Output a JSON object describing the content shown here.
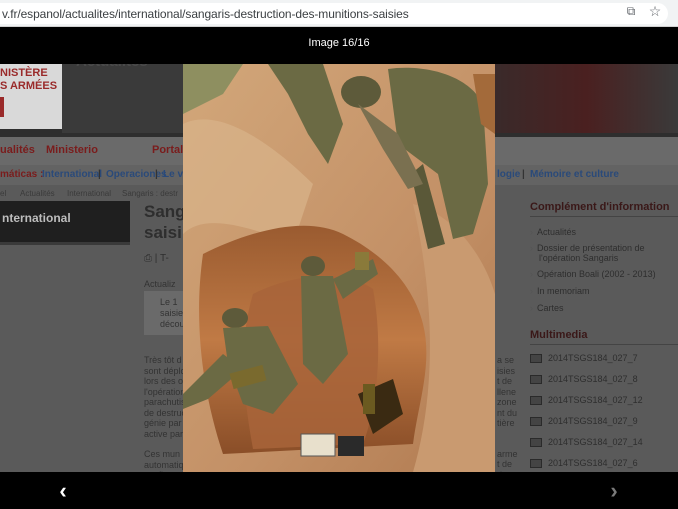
{
  "browser": {
    "url": "v.fr/espanol/actualites/international/sangaris-destruction-des-munitions-saisies",
    "translate_icon": "translate-icon",
    "bookmark_icon": "star-icon"
  },
  "page": {
    "logo_lines": [
      "NISTÈRE",
      "S ARMÉES"
    ],
    "header_title": "Actualités",
    "nav": {
      "actualites": "ualités",
      "ministerio": "Ministerio",
      "portal": "Portal"
    },
    "tematicas": {
      "label": "máticas :",
      "international": "International",
      "operaciones": "Operaciones",
      "partial": "Le v",
      "ologie": "logie",
      "memoire": "Mémoire et culture",
      "sep": "|"
    },
    "breadcrumb": [
      "el",
      "Actualités",
      "International",
      "Sangaris : destr"
    ],
    "section": "nternational",
    "article_title": [
      "Sang",
      "saisi"
    ],
    "toolbar": "⎙  | T- ",
    "updated": "Actualiz",
    "lead": [
      "Le 1",
      "saisie",
      "décou"
    ],
    "body_left": [
      "Très tôt d",
      "sont déplo",
      "lors des o",
      "l'opération",
      "parachutis",
      "de destruc",
      "génie par",
      "active par",
      "",
      "Ces mun",
      "automatiq",
      "confiance"
    ],
    "body_right": [
      "a se",
      "isies",
      "t de",
      "llene",
      "zone",
      "nt du",
      "tière",
      "",
      "",
      "arme",
      "t de",
      "de"
    ],
    "complement": {
      "heading": "Complément d'information",
      "items": [
        "Actualités",
        "Dossier de présentation de",
        "l'opération Sangaris",
        "Opération Boali (2002 - 2013)",
        "In memoriam",
        "Cartes"
      ]
    },
    "multimedia": {
      "heading": "Multimedia",
      "items": [
        "2014TSGS184_027_7",
        "2014TSGS184_027_8",
        "2014TSGS184_027_12",
        "2014TSGS184_027_9",
        "2014TSGS184_027_14",
        "2014TSGS184_027_6"
      ]
    }
  },
  "lightbox": {
    "caption": "Image 16/16",
    "prev": "‹",
    "next": "›"
  },
  "colors": {
    "accent_red": "#7a1c1c",
    "link_blue": "#2a4a7a",
    "lightbox_bg": "#000000"
  }
}
